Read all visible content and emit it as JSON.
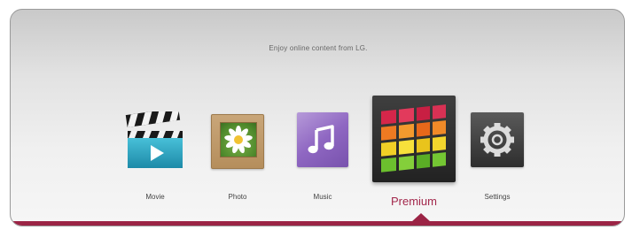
{
  "screen": {
    "tagline": "Enjoy online content from LG.",
    "accent_color": "#9b2445",
    "selected_item": "Premium"
  },
  "menu": {
    "items": [
      {
        "id": "movie",
        "label": "Movie",
        "icon": "movie-clapperboard-icon"
      },
      {
        "id": "photo",
        "label": "Photo",
        "icon": "photo-flower-icon"
      },
      {
        "id": "music",
        "label": "Music",
        "icon": "music-note-icon"
      },
      {
        "id": "premium",
        "label": "Premium",
        "icon": "premium-color-grid-icon"
      },
      {
        "id": "settings",
        "label": "Settings",
        "icon": "gear-icon"
      }
    ]
  }
}
